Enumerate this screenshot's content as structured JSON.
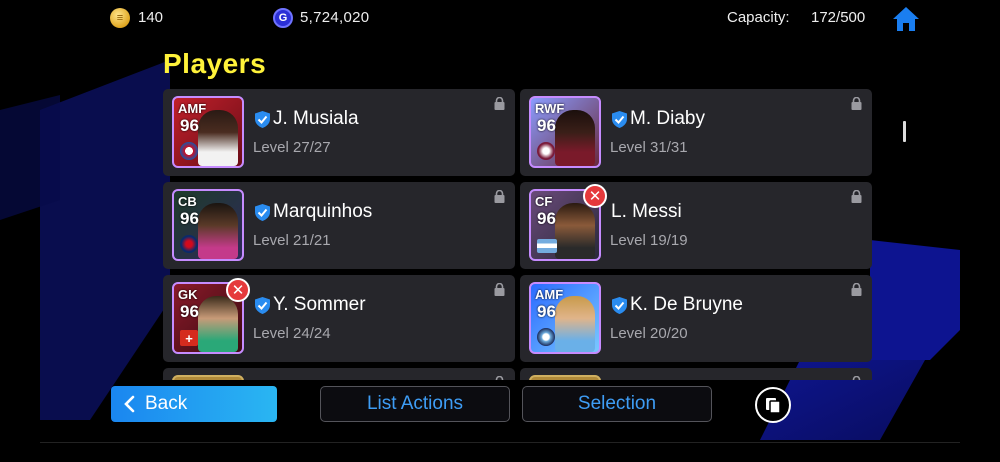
{
  "topbar": {
    "coin_icon": "coin-icon",
    "coins": "140",
    "gp_icon": "gp-icon",
    "gp_letter": "G",
    "gp": "5,724,020",
    "capacity_label": "Capacity:",
    "capacity_value": "172/500",
    "home_icon": "home-icon"
  },
  "page_title": "Players",
  "players": [
    {
      "position": "AMF",
      "rating": "96",
      "name": "J. Musiala",
      "level": "Level 27/27",
      "removable": false
    },
    {
      "position": "RWF",
      "rating": "96",
      "name": "M. Diaby",
      "level": "Level 31/31",
      "removable": false
    },
    {
      "position": "CB",
      "rating": "96",
      "name": "Marquinhos",
      "level": "Level 21/21",
      "removable": false
    },
    {
      "position": "CF",
      "rating": "96",
      "name": "L. Messi",
      "level": "Level 19/19",
      "removable": true
    },
    {
      "position": "GK",
      "rating": "96",
      "name": "Y. Sommer",
      "level": "Level 24/24",
      "removable": true
    },
    {
      "position": "AMF",
      "rating": "96",
      "name": "K. De Bruyne",
      "level": "Level 20/20",
      "removable": false
    }
  ],
  "remove_symbol": "✕",
  "buttons": {
    "back": "Back",
    "list_actions": "List Actions",
    "selection": "Selection"
  },
  "colors": {
    "title": "#fff23a",
    "accent_blue": "#3e9df5",
    "card_bg": "#26262b",
    "remove_red": "#e5393c"
  }
}
